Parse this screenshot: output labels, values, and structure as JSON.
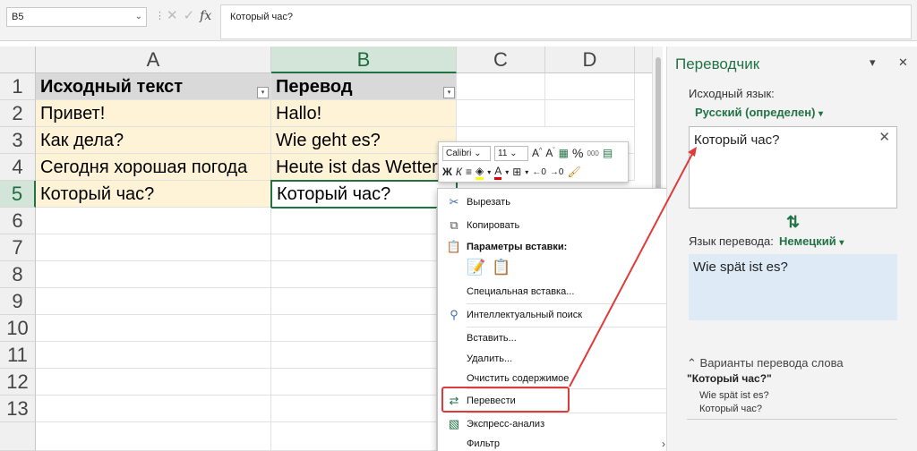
{
  "formula_bar": {
    "name_box": "B5",
    "formula": "Который час?",
    "fx_label": "fx"
  },
  "sheet": {
    "columns": [
      "A",
      "B",
      "C",
      "D"
    ],
    "rows": [
      "1",
      "2",
      "3",
      "4",
      "5",
      "6",
      "7",
      "8",
      "9",
      "10",
      "11",
      "12",
      "13"
    ],
    "cells": {
      "A1": "Исходный текст",
      "B1": "Перевод",
      "A2": "Привет!",
      "B2": "Hallo!",
      "A3": "Как дела?",
      "B3": "Wie geht es?",
      "A4": "Сегодня хорошая погода",
      "B4": "Heute ist das Wetter",
      "A5": "Который час?",
      "B5": "Который час?"
    },
    "filter_glyph": "▾"
  },
  "mini_toolbar": {
    "font_name": "Calibri",
    "font_size": "11",
    "bold": "Ж",
    "italic": "К",
    "percent": "%",
    "thousands": "000"
  },
  "context_menu": {
    "items": {
      "cut": "Вырезать",
      "copy": "Копировать",
      "paste_options": "Параметры вставки:",
      "paste_special": "Специальная вставка...",
      "smart_lookup": "Интеллектуальный поиск",
      "insert": "Вставить...",
      "delete": "Удалить...",
      "clear": "Очистить содержимое",
      "translate": "Перевести",
      "quick_analysis": "Экспресс-анализ",
      "filter": "Фильтр"
    }
  },
  "translator": {
    "title": "Переводчик",
    "source_label": "Исходный язык:",
    "source_lang": "Русский (определен)",
    "source_text": "Который час?",
    "target_label": "Язык перевода:",
    "target_lang": "Немецкий",
    "target_text": "Wie spät ist es?",
    "variants_title": "Варианты перевода слова",
    "variants_word": "\"Который час?\"",
    "variants": [
      "Wie spät ist es?",
      "Который час?"
    ]
  },
  "colors": {
    "excel_green": "#217346",
    "highlight_red": "#e03b3b",
    "data_fill": "#fef3d7",
    "header_fill": "#d9d9d9",
    "output_fill": "#deebf7"
  }
}
